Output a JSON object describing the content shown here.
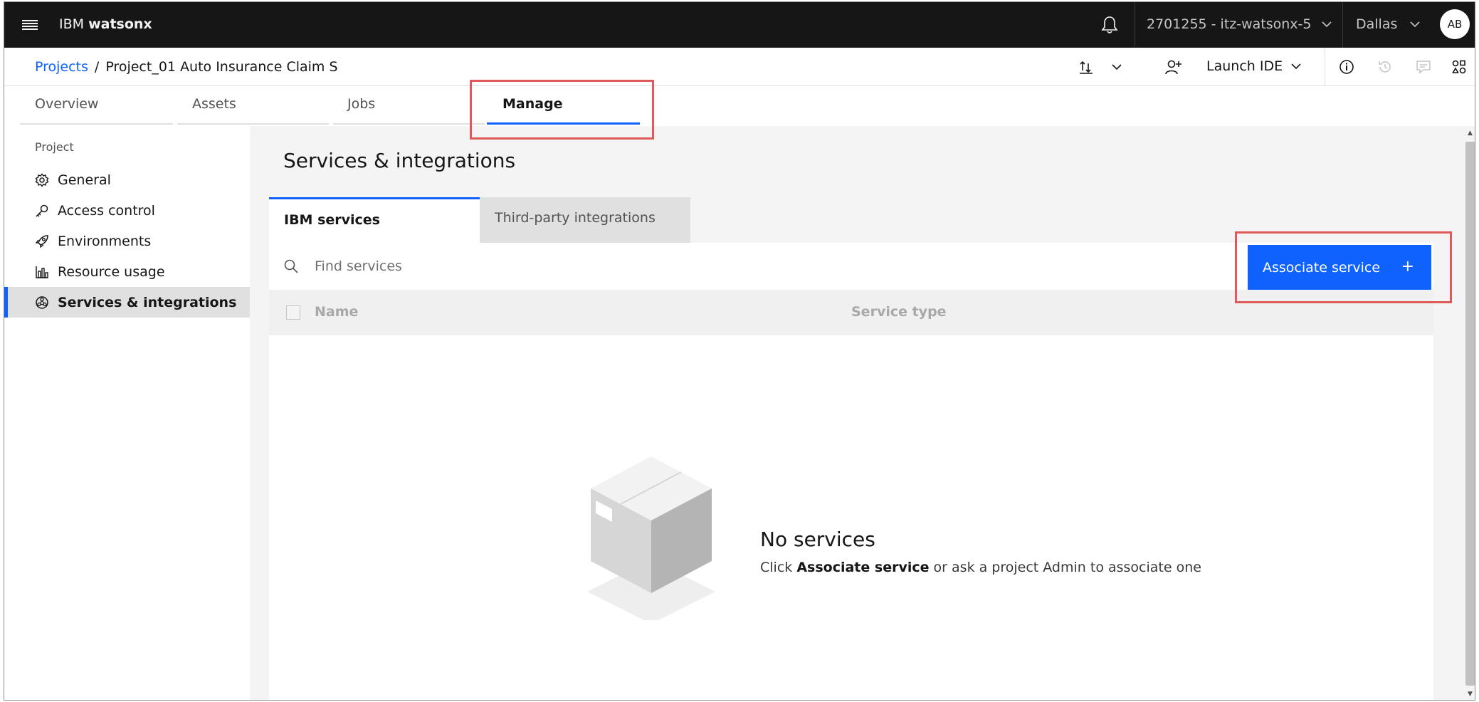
{
  "header": {
    "brand_prefix": "IBM",
    "brand_name": "watsonx",
    "account": "2701255 - itz-watsonx-5",
    "region": "Dallas",
    "avatar_initials": "AB"
  },
  "breadcrumb": {
    "root": "Projects",
    "separator": "/",
    "current": "Project_01 Auto Insurance Claim S"
  },
  "toolbar": {
    "launch_ide": "Launch IDE"
  },
  "tabs": [
    {
      "label": "Overview"
    },
    {
      "label": "Assets"
    },
    {
      "label": "Jobs"
    },
    {
      "label": "Manage"
    }
  ],
  "sidebar": {
    "heading": "Project",
    "items": [
      {
        "label": "General",
        "icon": "gear-icon"
      },
      {
        "label": "Access control",
        "icon": "key-icon"
      },
      {
        "label": "Environments",
        "icon": "rocket-icon"
      },
      {
        "label": "Resource usage",
        "icon": "bar-chart-icon"
      },
      {
        "label": "Services & integrations",
        "icon": "network-icon"
      }
    ]
  },
  "main": {
    "title": "Services & integrations",
    "subtabs": [
      {
        "label": "IBM services"
      },
      {
        "label": "Third-party integrations"
      }
    ],
    "search_placeholder": "Find services",
    "associate_button": "Associate service",
    "columns": [
      "Name",
      "Service type"
    ],
    "empty_title": "No services",
    "empty_text_prefix": "Click",
    "empty_text_bold": "Associate service",
    "empty_text_suffix": "or ask a project Admin to associate one"
  },
  "colors": {
    "accent": "#0f62fe",
    "header_bg": "#161616",
    "highlight": "#e05a5a"
  }
}
